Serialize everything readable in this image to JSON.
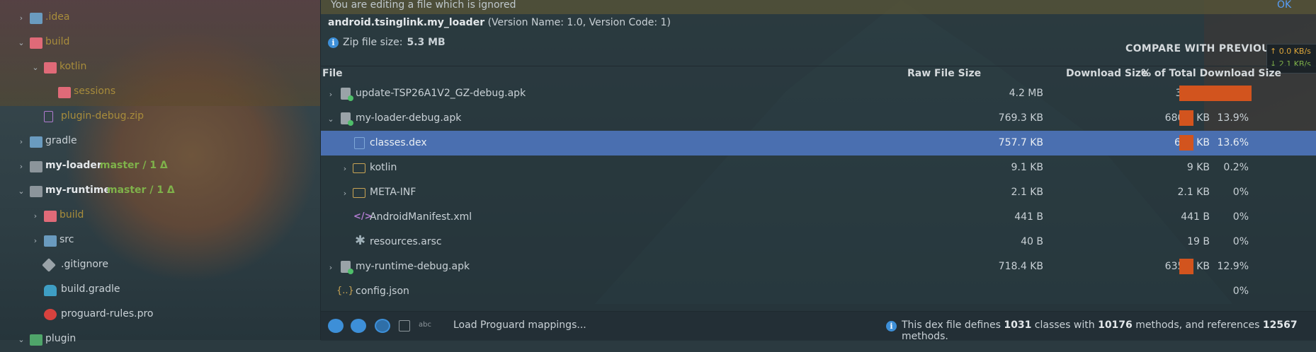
{
  "project_tree": {
    "items": [
      {
        "label": ".idea",
        "suffix": ""
      },
      {
        "label": "build",
        "suffix": ""
      },
      {
        "label": "kotlin",
        "suffix": ""
      },
      {
        "label": "sessions",
        "suffix": ""
      },
      {
        "label": "plugin-debug.zip",
        "suffix": ""
      },
      {
        "label": "gradle",
        "suffix": ""
      },
      {
        "label": "my-loader",
        "suffix": "master / 1 Δ"
      },
      {
        "label": "my-runtime",
        "suffix": "master / 1 Δ"
      },
      {
        "label": "build",
        "suffix": ""
      },
      {
        "label": "src",
        "suffix": ""
      },
      {
        "label": ".gitignore",
        "suffix": ""
      },
      {
        "label": "build.gradle",
        "suffix": ""
      },
      {
        "label": "proguard-rules.pro",
        "suffix": ""
      },
      {
        "label": "plugin",
        "suffix": ""
      }
    ]
  },
  "banner": {
    "text": "You are editing a file which is ignored",
    "ok": "OK"
  },
  "apk": {
    "name": "android.tsinglink.my_loader",
    "version": "(Version Name: 1.0, Version Code: 1)",
    "zip_label": "Zip file size:",
    "zip_value": "5.3 MB",
    "compare": "COMPARE WITH PREVIOUS APK"
  },
  "network": {
    "up": "↑ 0.0 KB/s",
    "down": "↓ 2.1 KB/s"
  },
  "table": {
    "headers": {
      "file": "File",
      "raw": "Raw File Size",
      "download": "Download Size",
      "pct": "% of Total Download Size"
    },
    "rows": [
      {
        "name": "update-TSP26A1V2_GZ-debug.apk",
        "raw": "4.2 MB",
        "download": "3.5 MB",
        "pct": "73.2%",
        "share": 0.732
      },
      {
        "name": "my-loader-debug.apk",
        "raw": "769.3 KB",
        "download": "680.6 KB",
        "pct": "13.9%",
        "share": 0.139
      },
      {
        "name": "classes.dex",
        "raw": "757.7 KB",
        "download": "669 KB",
        "pct": "13.6%",
        "share": 0.136
      },
      {
        "name": "kotlin",
        "raw": "9.1 KB",
        "download": "9 KB",
        "pct": "0.2%",
        "share": 0.002
      },
      {
        "name": "META-INF",
        "raw": "2.1 KB",
        "download": "2.1 KB",
        "pct": "0%",
        "share": 0
      },
      {
        "name": "AndroidManifest.xml",
        "raw": "441 B",
        "download": "441 B",
        "pct": "0%",
        "share": 0
      },
      {
        "name": "resources.arsc",
        "raw": "40 B",
        "download": "19 B",
        "pct": "0%",
        "share": 0
      },
      {
        "name": "my-runtime-debug.apk",
        "raw": "718.4 KB",
        "download": "635.4 KB",
        "pct": "12.9%",
        "share": 0.129
      },
      {
        "name": "config.json",
        "raw": "",
        "download": "",
        "pct": "0%",
        "share": 0
      }
    ]
  },
  "footer": {
    "load_mappings": "Load Proguard mappings...",
    "dex_prefix": "This dex file defines",
    "classes": "1031",
    "classes_word": "classes with",
    "methods": "10176",
    "methods_word": "methods, and references",
    "refs": "12567",
    "refs_word": "methods."
  }
}
